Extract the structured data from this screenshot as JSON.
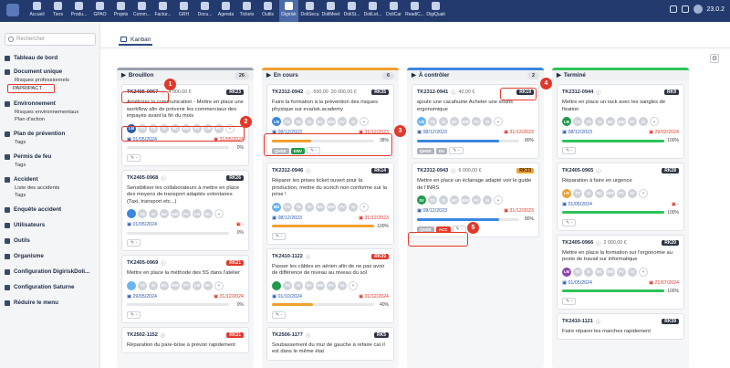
{
  "topbar": {
    "items": [
      "Accueil",
      "Tiers",
      "Produ...",
      "GPAO",
      "Projets",
      "Comm...",
      "Factur...",
      "GRH",
      "Docu...",
      "Agenda",
      "Tickets",
      "Outils",
      "Digirisk",
      "DoliSecu",
      "DoliMeet",
      "DoliSt...",
      "DoliLet...",
      "DoliCar",
      "ReadiC...",
      "DigiQuali"
    ],
    "active_index": 12,
    "version": "23.0.2"
  },
  "sidebar": {
    "search_placeholder": "Rechercher",
    "menu": [
      {
        "label": "Tableau de bord",
        "type": "main"
      },
      {
        "label": "Document unique",
        "type": "main"
      },
      {
        "label": "Risques professionnels",
        "type": "sub"
      },
      {
        "label": "PAPRIPACT",
        "type": "sub",
        "selected": true
      },
      {
        "label": "Environnement",
        "type": "main"
      },
      {
        "label": "Risques environnementaux",
        "type": "sub"
      },
      {
        "label": "Plan d'action",
        "type": "sub"
      },
      {
        "label": "Plan de prévention",
        "type": "main"
      },
      {
        "label": "Tags",
        "type": "sub"
      },
      {
        "label": "Permis de feu",
        "type": "main"
      },
      {
        "label": "Tags",
        "type": "sub"
      },
      {
        "label": "Accident",
        "type": "main"
      },
      {
        "label": "Liste des accidents",
        "type": "sub"
      },
      {
        "label": "Tags",
        "type": "sub"
      },
      {
        "label": "Enquête accident",
        "type": "main"
      },
      {
        "label": "Utilisateurs",
        "type": "main"
      },
      {
        "label": "Outils",
        "type": "main"
      },
      {
        "label": "Organisme",
        "type": "main"
      },
      {
        "label": "Configuration DigiriskDoli...",
        "type": "main"
      },
      {
        "label": "Configuration Saturne",
        "type": "main"
      },
      {
        "label": "Réduire le menu",
        "type": "main"
      }
    ]
  },
  "main": {
    "tab": "Kanban"
  },
  "colors": {
    "brouillon": "#9aa1ad",
    "encours": "#f0a030",
    "acontroler": "#3a86e0",
    "termine": "#2ec25a",
    "accent": "#e2382b"
  },
  "columns": [
    {
      "title": "Brouillon",
      "count": "26",
      "cards": [
        {
          "ref": "TK2405-0967",
          "amount": "4 000,00 €",
          "badge": "RK23",
          "badge_color": "dark",
          "text": "Améliorer la communication - Mettre en place une workflow afin de prévenir les commerciaux des impayés avant la fin du mois",
          "avatars": [
            "LM",
            "CG",
            "TD",
            "SI",
            "BC",
            "MW",
            "PV",
            "LM",
            "BC"
          ],
          "start": "01/05/2024",
          "end": "31/05/2024",
          "progress": 0,
          "pct": "0%"
        },
        {
          "ref": "TK2405-0968",
          "amount": "",
          "badge": "RK26",
          "badge_color": "dark",
          "text": "Sensibiliser les collaborateurs à mettre en place des moyens de transport adaptés volontaires (Taxi, transport etc...)",
          "avatars": [
            "",
            "TD",
            "SI",
            "BC",
            "MW",
            "PV",
            "LM",
            "BC"
          ],
          "start": "01/05/2024",
          "end": "-",
          "progress": 0,
          "pct": "0%"
        },
        {
          "ref": "TK2405-0969",
          "amount": "",
          "badge": "RK21",
          "badge_color": "red",
          "text": "Mettre en place la méthode des 5S dans l'atelier",
          "avatars": [
            "",
            "TD",
            "SI",
            "BC",
            "MW",
            "PV",
            "LM",
            "BC"
          ],
          "start": "29/05/2024",
          "end": "31/12/2024",
          "progress": 0,
          "pct": "0%"
        },
        {
          "ref": "TK2502-1152",
          "amount": "",
          "badge": "RK31",
          "badge_color": "red",
          "text": "Réparation du pare-brise à prévoir rapidement"
        }
      ]
    },
    {
      "title": "En cours",
      "count": "6",
      "cards": [
        {
          "ref": "TK2312-0942",
          "amount": "20 000,00 €",
          "amount2": "500,00",
          "badge": "RK35",
          "badge_color": "dark",
          "text": "Faire la formation à la prévention des risques physique sur evarisk.academy",
          "avatars": [
            "LM",
            "CG",
            "TD",
            "SI",
            "BC",
            "MW",
            "PV",
            "SI"
          ],
          "start": "08/12/2023",
          "end": "31/12/2023",
          "progress": 38,
          "pct": "38%",
          "tags": [
            {
              "t": "QHSE",
              "c": "grey"
            },
            {
              "t": "ENV",
              "c": "green"
            }
          ]
        },
        {
          "ref": "TK2312-0946",
          "amount": "",
          "badge": "RK14",
          "badge_color": "dark",
          "text": "Réparer les prises ticket ouvert pour la production, mettre du scotch non conforme sur la prise !",
          "avatars": [
            "MD",
            "CG",
            "TD",
            "SI",
            "BC",
            "MW",
            "PV",
            "SI"
          ],
          "start": "08/12/2023",
          "end": "31/12/2023",
          "progress": 100,
          "pct": "100%"
        },
        {
          "ref": "TK2410-1122",
          "amount": "",
          "badge": "RK39",
          "badge_color": "red",
          "text": "Passer les câbles en aérien afin de ne pas avoir de différence de niveau au niveau du sol",
          "avatars": [
            "",
            "TD",
            "SI",
            "BC",
            "MW",
            "PV",
            "SI"
          ],
          "start": "01/10/2024",
          "end": "31/12/2024",
          "progress": 40,
          "pct": "40%"
        },
        {
          "ref": "TK2506-1177",
          "amount": "",
          "badge": "RK5",
          "badge_color": "dark",
          "text": "Soubassement du mur de gauche à refaire car il est dans le même état"
        }
      ]
    },
    {
      "title": "À contrôler",
      "count": "2",
      "cards": [
        {
          "ref": "TK2312-0941",
          "amount": "40,00 €",
          "badge": "RK19",
          "badge_color": "dark",
          "text": "ajoute une cacahuète Acheter une souris ergonomique",
          "avatars": [
            "LM",
            "TD",
            "SI",
            "BC",
            "MW",
            "PV",
            "SI"
          ],
          "start": "08/12/2023",
          "end": "31/12/2023",
          "progress": 80,
          "pct": "80%",
          "tags": [
            {
              "t": "QHSE",
              "c": "grey"
            },
            {
              "t": "DU",
              "c": "grey"
            }
          ]
        },
        {
          "ref": "TK2312-0943",
          "amount": "6 000,00 €",
          "badge": "RK33",
          "badge_color": "orange",
          "text": "Mettre en place un éclairage adapté voir le guide de l'INRS",
          "avatars": [
            "SV",
            "TD",
            "SI",
            "BC",
            "MW",
            "PV",
            "SI"
          ],
          "start": "08/12/2023",
          "end": "31/12/2023",
          "progress": 80,
          "pct": "80%",
          "tags": [
            {
              "t": "QHSE",
              "c": "grey"
            },
            {
              "t": "ACC",
              "c": "red"
            }
          ]
        }
      ]
    },
    {
      "title": "Terminé",
      "count": "",
      "cards": [
        {
          "ref": "TK2312-0944",
          "amount": "",
          "badge": "RK9",
          "badge_color": "dark",
          "text": "Mettre en place un rack avec les sangles de fixation",
          "avatars": [
            "LM",
            "CG",
            "TD",
            "SI",
            "BC",
            "MW",
            "PV",
            "SI"
          ],
          "start": "08/12/2023",
          "end": "29/02/2024",
          "progress": 100,
          "pct": "100%"
        },
        {
          "ref": "TK2405-0965",
          "amount": "",
          "badge": "RK28",
          "badge_color": "dark",
          "text": "Réparation à faire en urgence",
          "avatars": [
            "LM",
            "TD",
            "SI",
            "BC",
            "MW",
            "PV",
            "SI"
          ],
          "start": "01/05/2024",
          "end": "-",
          "progress": 100,
          "pct": "100%"
        },
        {
          "ref": "TK2405-0966",
          "amount": "2 000,00 €",
          "badge": "RK20",
          "badge_color": "dark",
          "text": "Mettre en place la formation sur l'ergonomie au poste de travail sur informatique",
          "avatars": [
            "LM",
            "TD",
            "SI",
            "BC",
            "MW",
            "PV",
            "SI"
          ],
          "start": "01/05/2024",
          "end": "21/07/2024",
          "progress": 100,
          "pct": "100%"
        },
        {
          "ref": "TK2410-1121",
          "amount": "",
          "badge": "RK39",
          "badge_color": "dark",
          "text": "Faire réparer les marches rapidement"
        }
      ]
    }
  ],
  "annotations": [
    "1",
    "2",
    "3",
    "4",
    "5"
  ]
}
